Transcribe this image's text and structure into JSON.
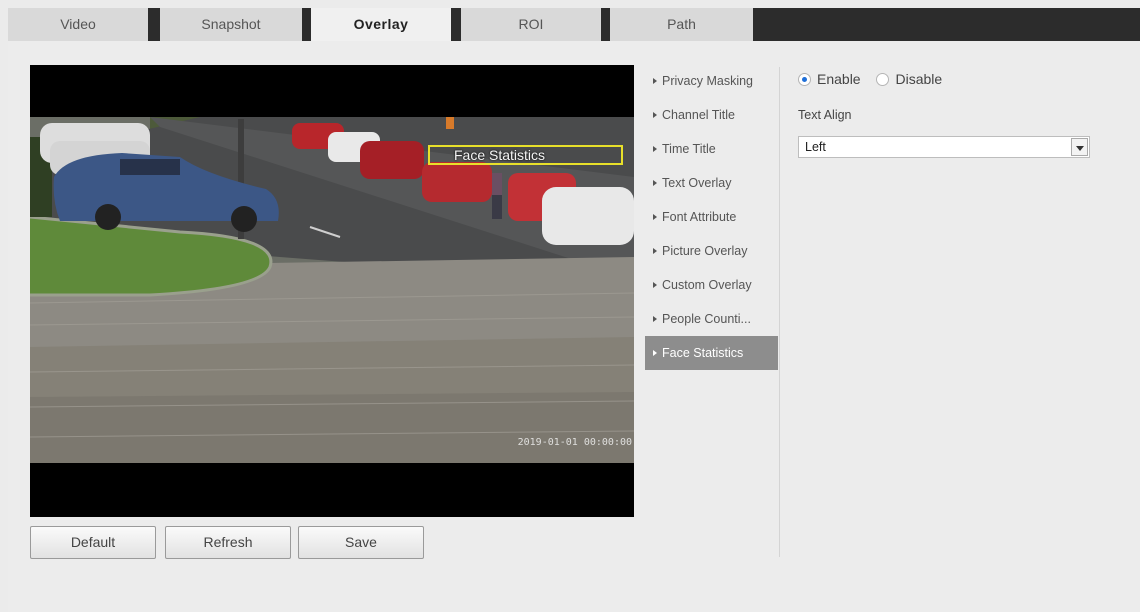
{
  "tabs": [
    {
      "label": "Video"
    },
    {
      "label": "Snapshot"
    },
    {
      "label": "Overlay"
    },
    {
      "label": "ROI"
    },
    {
      "label": "Path"
    }
  ],
  "active_tab": "Overlay",
  "preview": {
    "osd_text": "Face Statistics",
    "time_text": "2019-01-01 00:00:00"
  },
  "buttons": {
    "default": "Default",
    "refresh": "Refresh",
    "save": "Save"
  },
  "menu": {
    "items": [
      {
        "label": "Privacy Masking"
      },
      {
        "label": "Channel Title"
      },
      {
        "label": "Time Title"
      },
      {
        "label": "Text Overlay"
      },
      {
        "label": "Font Attribute"
      },
      {
        "label": "Picture Overlay"
      },
      {
        "label": "Custom Overlay"
      },
      {
        "label": "People Counti..."
      },
      {
        "label": "Face Statistics"
      }
    ],
    "active": "Face Statistics"
  },
  "settings": {
    "enable_label": "Enable",
    "disable_label": "Disable",
    "selected": "Enable",
    "text_align_label": "Text Align",
    "text_align_value": "Left"
  },
  "colors": {
    "tab_bar": "#2c2c2c",
    "active_menu": "#8d8d8d",
    "osd_box": "#e8e02a",
    "radio_selected": "#1f6fd8"
  }
}
